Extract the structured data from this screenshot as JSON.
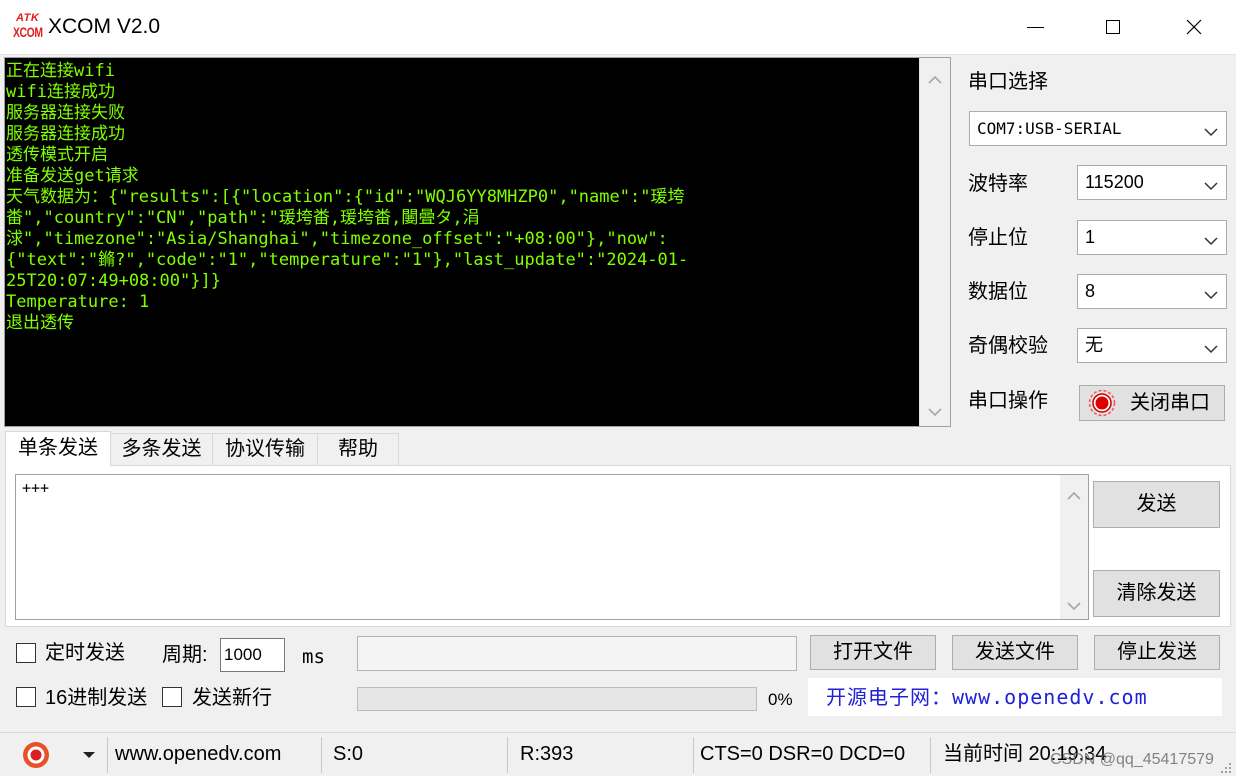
{
  "window": {
    "logo_top": "ATK",
    "logo_bottom": "XCOM",
    "title": "XCOM V2.0",
    "controls": [
      "minimize-icon",
      "maximize-icon",
      "close-icon"
    ]
  },
  "colors": {
    "receive_bg": "#000000",
    "receive_text": "#80ff00",
    "logo": "#e02020",
    "link": "#2020d8",
    "status_icon": "#e8502a",
    "port_led": "#e00000"
  },
  "receive": {
    "lines": [
      "正在连接wifi",
      "wifi连接成功",
      "服务器连接失败",
      "服务器连接成功",
      "透传模式开启",
      "准备发送get请求",
      "天气数据为：{\"results\":[{\"location\":{\"id\":\"WQJ6YY8MHZP0\",\"name\":\"瑗垮",
      "畨\",\"country\":\"CN\",\"path\":\"瑗垮畨,瑗垮畨,闄曡タ,涓",
      "浗\",\"timezone\":\"Asia/Shanghai\",\"timezone_offset\":\"+08:00\"},\"now\":",
      "{\"text\":\"鏅?\",\"code\":\"1\",\"temperature\":\"1\"},\"last_update\":\"2024-01-",
      "25T20:07:49+08:00\"}]}",
      "Temperature: 1",
      "退出透传"
    ]
  },
  "serial": {
    "port": {
      "label": "串口选择",
      "value": "COM7:USB-SERIAL"
    },
    "baud": {
      "label": "波特率",
      "value": "115200"
    },
    "stop_bits": {
      "label": "停止位",
      "value": "1"
    },
    "data_bits": {
      "label": "数据位",
      "value": "8"
    },
    "parity": {
      "label": "奇偶校验",
      "value": "无"
    },
    "operation": {
      "label": "串口操作",
      "button": "关闭串口",
      "icon": "port-status-led-icon"
    }
  },
  "tabs": [
    {
      "label": "单条发送",
      "active": true
    },
    {
      "label": "多条发送",
      "active": false
    },
    {
      "label": "协议传输",
      "active": false
    },
    {
      "label": "帮助",
      "active": false
    }
  ],
  "send": {
    "text": "+++",
    "send_button": "发送",
    "clear_button": "清除发送"
  },
  "options": {
    "timed_send": {
      "label": "定时发送",
      "checked": false
    },
    "period_label": "周期:",
    "period_value": "1000",
    "period_unit": "ms",
    "open_file_button": "打开文件",
    "send_file_button": "发送文件",
    "stop_send_button": "停止发送",
    "hex_send": {
      "label": "16进制发送",
      "checked": false
    },
    "new_line": {
      "label": "发送新行",
      "checked": false
    },
    "progress": 0,
    "progress_text": "0%",
    "website_banner": "开源电子网：www.openedv.com"
  },
  "status": {
    "icon": "xcom-status-icon",
    "url": "www.openedv.com",
    "sent": "S:0",
    "received": "R:393",
    "signals": "CTS=0 DSR=0 DCD=0",
    "time": "当前时间 20:19:34"
  },
  "watermark": "CSDN @qq_45417579"
}
